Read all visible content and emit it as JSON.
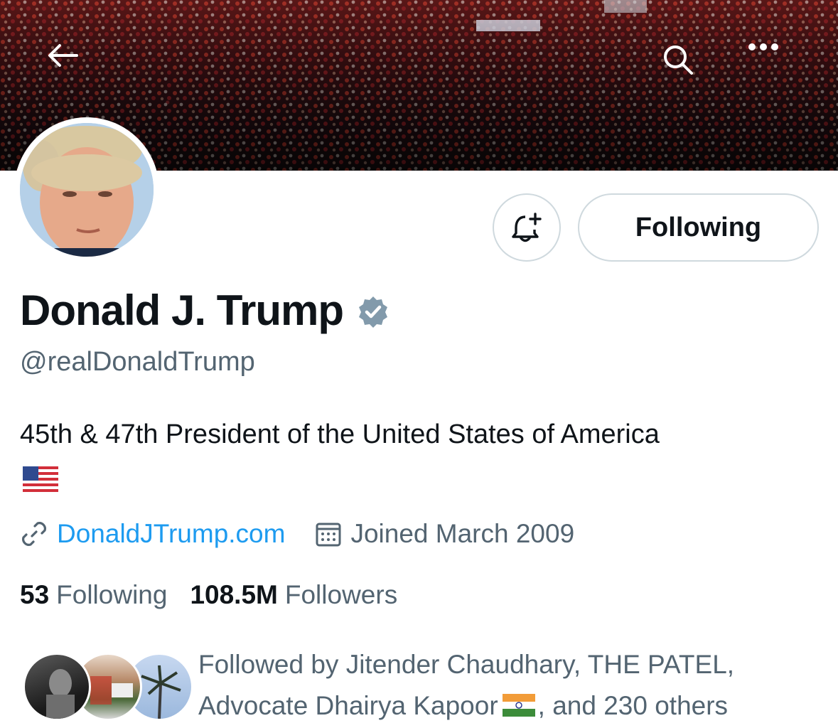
{
  "profile": {
    "name": "Donald J. Trump",
    "handle": "@realDonaldTrump",
    "bio": "45th & 47th President of the United States of America",
    "bio_emoji": "us-flag",
    "website": "DonaldJTrump.com",
    "joined": "Joined March 2009",
    "verified": true
  },
  "actions": {
    "following_label": "Following",
    "notify_icon": "bell-plus-icon"
  },
  "stats": {
    "following_count": "53",
    "following_label": "Following",
    "followers_count": "108.5M",
    "followers_label": "Followers"
  },
  "followed_by": {
    "prefix": "Followed by Jitender Chaudhary, THE PATEL, Advocate Dhairya Kapoor",
    "flag_emoji": "india-flag",
    "suffix": ", and 230 others"
  },
  "colors": {
    "link": "#1d9bf0",
    "secondary_text": "#536471",
    "primary_text": "#0f1419",
    "border": "#cfd9de",
    "verified_badge": "#829aab"
  }
}
